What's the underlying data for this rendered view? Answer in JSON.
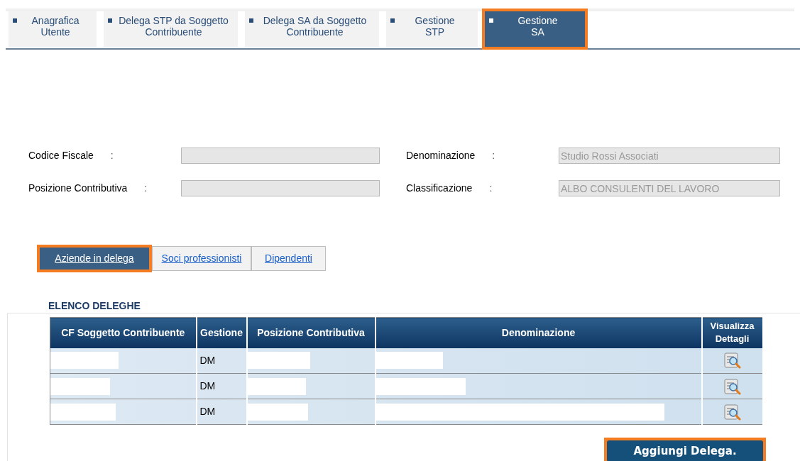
{
  "top_tabs": [
    {
      "label": "Anagrafica\nUtente",
      "selected": false,
      "highlighted": false
    },
    {
      "label": "Delega STP da Soggetto\nContribuente",
      "selected": false,
      "highlighted": false
    },
    {
      "label": "Delega SA da Soggetto\nContribuente",
      "selected": false,
      "highlighted": false
    },
    {
      "label": "Gestione\nSTP",
      "selected": false,
      "highlighted": false
    },
    {
      "label": "Gestione\nSA",
      "selected": true,
      "highlighted": true
    }
  ],
  "form": {
    "left": [
      {
        "label": "Codice Fiscale",
        "separator": ":"
      },
      {
        "label": "Posizione Contributiva",
        "separator": ":"
      }
    ],
    "right": [
      {
        "label": "Denominazione",
        "separator": ":",
        "value": "Studio Rossi Associati"
      },
      {
        "label": "Classificazione",
        "separator": ":",
        "value": "ALBO CONSULENTI DEL LAVORO"
      }
    ]
  },
  "sub_tabs": [
    {
      "label": "Aziende in delega",
      "selected": true,
      "highlighted": true
    },
    {
      "label": "Soci professionisti",
      "selected": false,
      "highlighted": false
    },
    {
      "label": "Dipendenti",
      "selected": false,
      "highlighted": false
    }
  ],
  "table": {
    "title": "ELENCO DELEGHE",
    "columns": [
      "CF Soggetto Contribuente",
      "Gestione",
      "Posizione Contributiva",
      "Denominazione",
      "Visualizza\nDettagli"
    ],
    "rows": [
      {
        "gestione": "DM"
      },
      {
        "gestione": "DM"
      },
      {
        "gestione": "DM"
      }
    ]
  },
  "add_button": {
    "label": "Aggiungi Delega.",
    "highlighted": true
  }
}
